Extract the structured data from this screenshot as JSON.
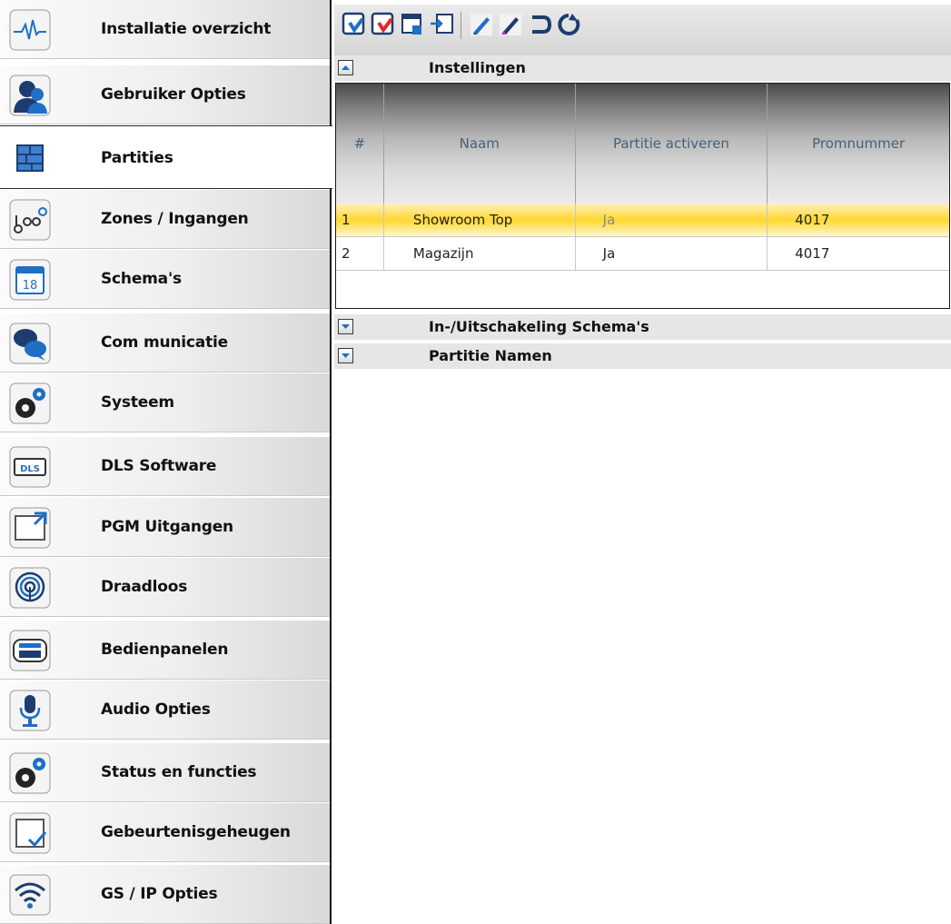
{
  "sidebar": {
    "active_index": 2,
    "items": [
      {
        "label": "Installatie overzicht",
        "icon": "heartbeat-icon"
      },
      {
        "label": "Gebruiker Opties",
        "icon": "users-icon"
      },
      {
        "label": "Partities",
        "icon": "partitions-grid-icon"
      },
      {
        "label": "Zones / Ingangen",
        "icon": "zones-icon"
      },
      {
        "label": "Schema's",
        "icon": "calendar-icon"
      },
      {
        "label": "Com municatie",
        "icon": "chat-icon"
      },
      {
        "label": "Systeem",
        "icon": "gears-icon"
      },
      {
        "label": "DLS Software",
        "icon": "dls-icon"
      },
      {
        "label": "PGM Uitgangen",
        "icon": "pgm-output-icon"
      },
      {
        "label": "Draadloos",
        "icon": "wireless-icon"
      },
      {
        "label": "Bedienpanelen",
        "icon": "keypad-icon"
      },
      {
        "label": "Audio Opties",
        "icon": "microphone-icon"
      },
      {
        "label": "Status en functies",
        "icon": "gears-icon"
      },
      {
        "label": "Gebeurtenisgeheugen",
        "icon": "event-log-icon"
      },
      {
        "label": "GS / IP Opties",
        "icon": "wifi-icon"
      }
    ]
  },
  "toolbar": {
    "buttons": [
      "read-icon",
      "write-icon",
      "read-selected-icon",
      "write-selected-icon",
      "edit-icon",
      "edit-alt-icon",
      "undo-icon",
      "refresh-icon"
    ]
  },
  "sections": {
    "instellingen": {
      "title": "Instellingen",
      "expanded": true
    },
    "schedules": {
      "title": "In-/Uitschakeling Schema's",
      "expanded": false
    },
    "partition_names": {
      "title": "Partitie Namen",
      "expanded": false
    }
  },
  "table": {
    "headers": [
      "#",
      "Naam",
      "Partitie activeren",
      "Promnummer"
    ],
    "rows": [
      {
        "num": "1",
        "naam": "Showroom Top",
        "activeren": "Ja",
        "prom": "4017",
        "selected": true
      },
      {
        "num": "2",
        "naam": "Magazijn",
        "activeren": "Ja",
        "prom": "4017",
        "selected": false
      }
    ]
  },
  "colors": {
    "selected_row": "#ffd830",
    "header_text": "#45607a",
    "icon_blue": "#1e6fc5"
  }
}
